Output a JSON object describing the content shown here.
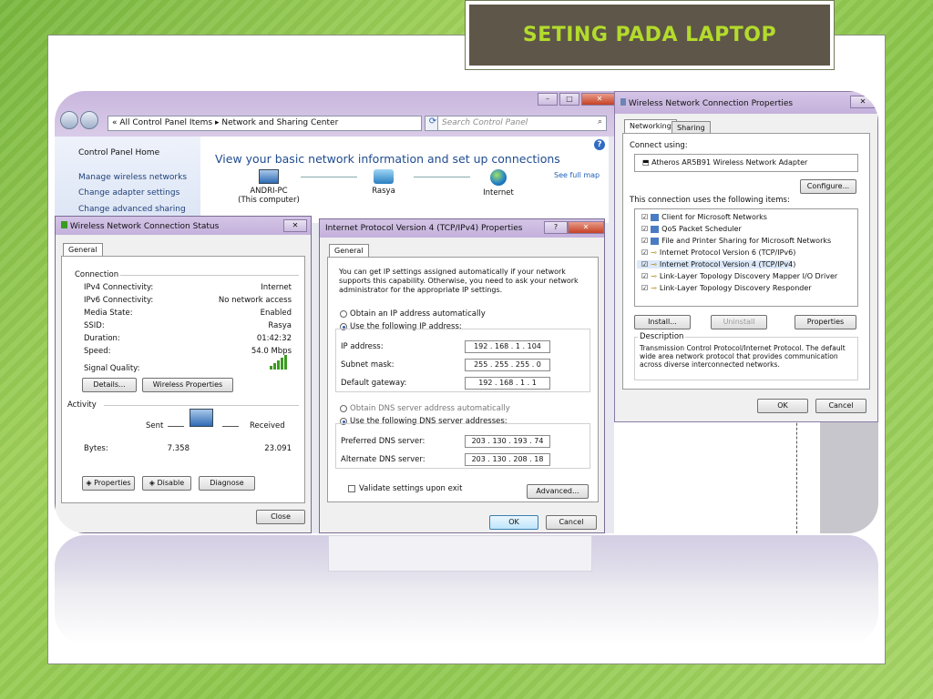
{
  "slide": {
    "title": "SETING PADA LAPTOP"
  },
  "control_panel": {
    "address": "« All Control Panel Items ▸ Network and Sharing Center",
    "search_placeholder": "Search Control Panel",
    "sidebar": [
      "Control Panel Home",
      "Manage wireless networks",
      "Change adapter settings",
      "Change advanced sharing"
    ],
    "heading": "View your basic network information and set up connections",
    "see_full_map": "See full map",
    "nodes": [
      {
        "label": "ANDRI-PC",
        "sub": "(This computer)"
      },
      {
        "label": "Rasya",
        "sub": ""
      },
      {
        "label": "Internet",
        "sub": ""
      }
    ],
    "window_buttons": [
      "–",
      "□",
      "✕"
    ]
  },
  "status_dialog": {
    "title": "Wireless Network Connection Status",
    "tab": "General",
    "connection_label": "Connection",
    "rows": [
      {
        "label": "IPv4 Connectivity:",
        "value": "Internet"
      },
      {
        "label": "IPv6 Connectivity:",
        "value": "No network access"
      },
      {
        "label": "Media State:",
        "value": "Enabled"
      },
      {
        "label": "SSID:",
        "value": "Rasya"
      },
      {
        "label": "Duration:",
        "value": "01:42:32"
      },
      {
        "label": "Speed:",
        "value": "54.0 Mbps"
      }
    ],
    "signal_label": "Signal Quality:",
    "details_btn": "Details...",
    "wireless_props_btn": "Wireless Properties",
    "activity_label": "Activity",
    "sent_label": "Sent",
    "received_label": "Received",
    "bytes_label": "Bytes:",
    "bytes_sent": "7.358",
    "bytes_received": "23.091",
    "properties_btn": "Properties",
    "disable_btn": "Disable",
    "diagnose_btn": "Diagnose",
    "close_btn": "Close",
    "close_x": "✕"
  },
  "ipv4_dialog": {
    "title": "Internet Protocol Version 4 (TCP/IPv4) Properties",
    "tab": "General",
    "description": "You can get IP settings assigned automatically if your network supports this capability. Otherwise, you need to ask your network administrator for the appropriate IP settings.",
    "auto_ip": "Obtain an IP address automatically",
    "manual_ip": "Use the following IP address:",
    "ip_label": "IP address:",
    "ip_value": "192 . 168 . 1 . 104",
    "mask_label": "Subnet mask:",
    "mask_value": "255 . 255 . 255 . 0",
    "gateway_label": "Default gateway:",
    "gateway_value": "192 . 168 . 1 . 1",
    "auto_dns": "Obtain DNS server address automatically",
    "manual_dns": "Use the following DNS server addresses:",
    "pref_dns_label": "Preferred DNS server:",
    "pref_dns_value": "203 . 130 . 193 . 74",
    "alt_dns_label": "Alternate DNS server:",
    "alt_dns_value": "203 . 130 . 208 . 18",
    "validate": "Validate settings upon exit",
    "advanced_btn": "Advanced...",
    "ok_btn": "OK",
    "cancel_btn": "Cancel",
    "help_btn": "?",
    "close_x": "✕"
  },
  "wnc_props": {
    "title": "Wireless Network Connection Properties",
    "tabs": [
      "Networking",
      "Sharing"
    ],
    "connect_using": "Connect using:",
    "adapter": "Atheros AR5B91 Wireless Network Adapter",
    "configure_btn": "Configure...",
    "items_label": "This connection uses the following items:",
    "items": [
      "Client for Microsoft Networks",
      "QoS Packet Scheduler",
      "File and Printer Sharing for Microsoft Networks",
      "Internet Protocol Version 6 (TCP/IPv6)",
      "Internet Protocol Version 4 (TCP/IPv4)",
      "Link-Layer Topology Discovery Mapper I/O Driver",
      "Link-Layer Topology Discovery Responder"
    ],
    "install_btn": "Install...",
    "uninstall_btn": "Uninstall",
    "properties_btn": "Properties",
    "description_label": "Description",
    "description": "Transmission Control Protocol/Internet Protocol. The default wide area network protocol that provides communication across diverse interconnected networks.",
    "ok_btn": "OK",
    "cancel_btn": "Cancel",
    "close_x": "✕"
  }
}
